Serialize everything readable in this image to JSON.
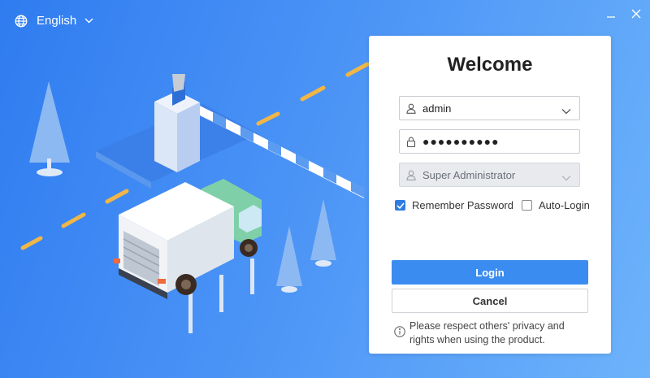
{
  "window": {
    "language": "English",
    "colors": {
      "background_start": "#2f7cf0",
      "background_end": "#6db3fb",
      "accent": "#3b8cf0"
    }
  },
  "login": {
    "title": "Welcome",
    "username": "admin",
    "password_mask": "●●●●●●●●●●",
    "role": "Super Administrator",
    "remember_password_label": "Remember Password",
    "remember_password_checked": true,
    "auto_login_label": "Auto-Login",
    "auto_login_checked": false,
    "login_label": "Login",
    "cancel_label": "Cancel",
    "notice": "Please respect others' privacy and\nrights when using the product."
  },
  "icons": [
    "globe-icon",
    "chevron-down-icon",
    "minimize-icon",
    "close-icon",
    "user-icon",
    "lock-icon",
    "info-icon",
    "check-icon"
  ]
}
